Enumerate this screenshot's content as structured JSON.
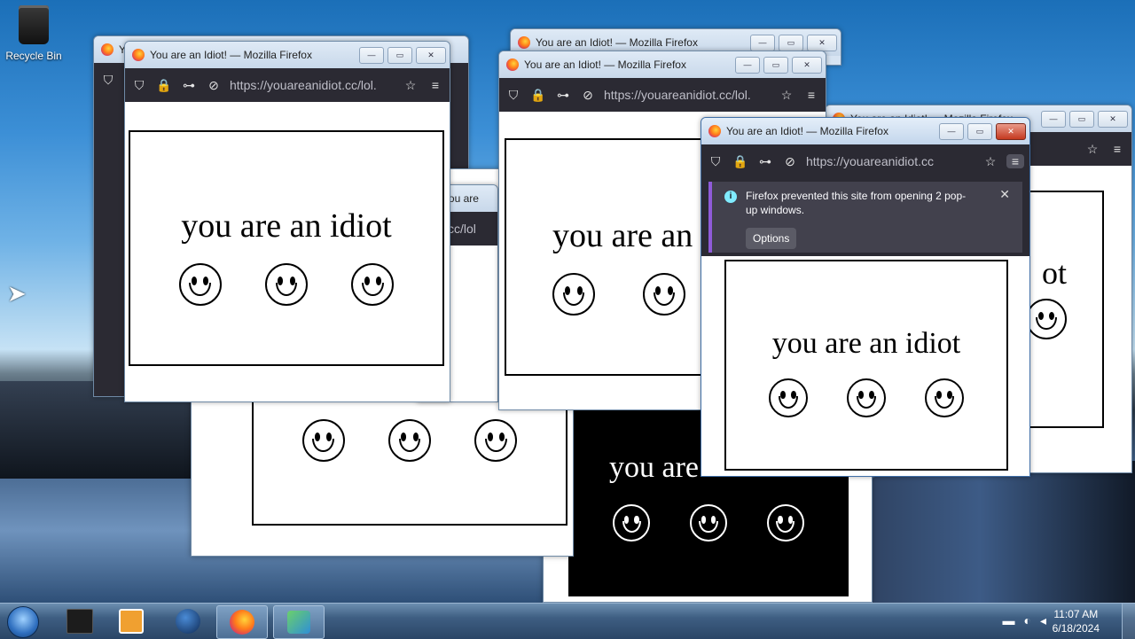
{
  "desktop": {
    "recycle_bin_label": "Recycle Bin"
  },
  "window": {
    "title": "You are an Idiot! — Mozilla Firefox",
    "title_short": "You are",
    "url": "https://youareanidiot.cc/lol.",
    "url_long": "https://youareanidiot.cc/lol.",
    "url_short": "https://youareanidiot.cc",
    "url_tail": "cc/lol",
    "page_text": "you are an idiot",
    "page_text_partial_1": "you are an",
    "page_text_partial_2": "di",
    "page_text_partial_3": "ot",
    "page_text_partial_4": "you are"
  },
  "notification": {
    "message": "Firefox prevented this site from opening 2 pop-up windows.",
    "options_label": "Options",
    "close_glyph": "✕"
  },
  "window_controls": {
    "minimize": "—",
    "maximize": "▭",
    "close": "✕"
  },
  "navbar_icons": {
    "shield": "⛉",
    "lock": "🔒",
    "permissions": "⊶",
    "tracking": "⊘",
    "star": "☆",
    "menu": "≡"
  },
  "taskbar": {
    "items": [
      "start",
      "terminal-app",
      "media-player",
      "network-globe",
      "firefox",
      "control-panel"
    ],
    "time": "11:07 AM",
    "date": "6/18/2024"
  },
  "colors": {
    "firefox_toolbar": "#2b2a33",
    "notice_bg": "#42414d",
    "notice_accent": "#8f5bd8",
    "close_red": "#c5391f"
  }
}
